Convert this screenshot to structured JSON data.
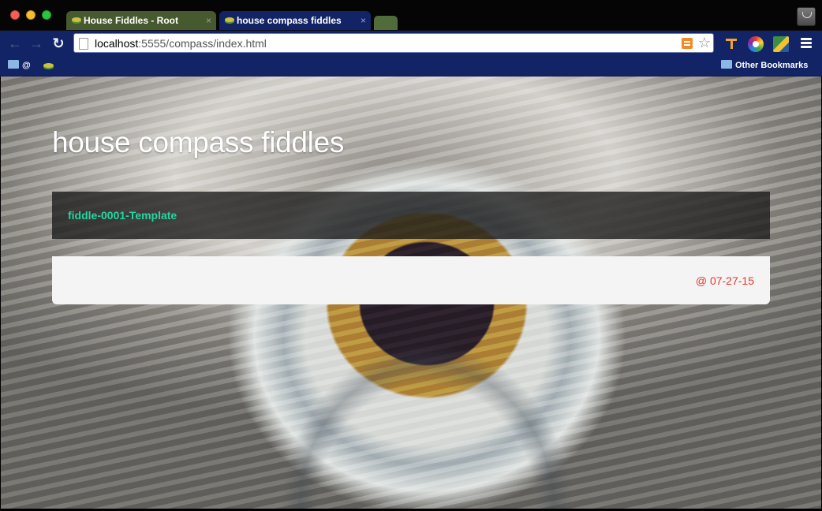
{
  "tabs": [
    {
      "label": "House Fiddles - Root",
      "close": "×"
    },
    {
      "label": "house compass fiddles",
      "close": "×"
    }
  ],
  "toolbar": {
    "url_host": "localhost",
    "url_path": ":5555/compass/index.html"
  },
  "bookmarks": {
    "item1_label": "@",
    "other_label": "Other Bookmarks"
  },
  "page": {
    "title": "house compass fiddles",
    "fiddle_link": "fiddle-0001-Template",
    "date": "@ 07-27-15"
  },
  "colors": {
    "tab_active": "#132466",
    "tab_inactive": "#47592f",
    "link": "#22d7a0",
    "date": "#e03a2b"
  }
}
